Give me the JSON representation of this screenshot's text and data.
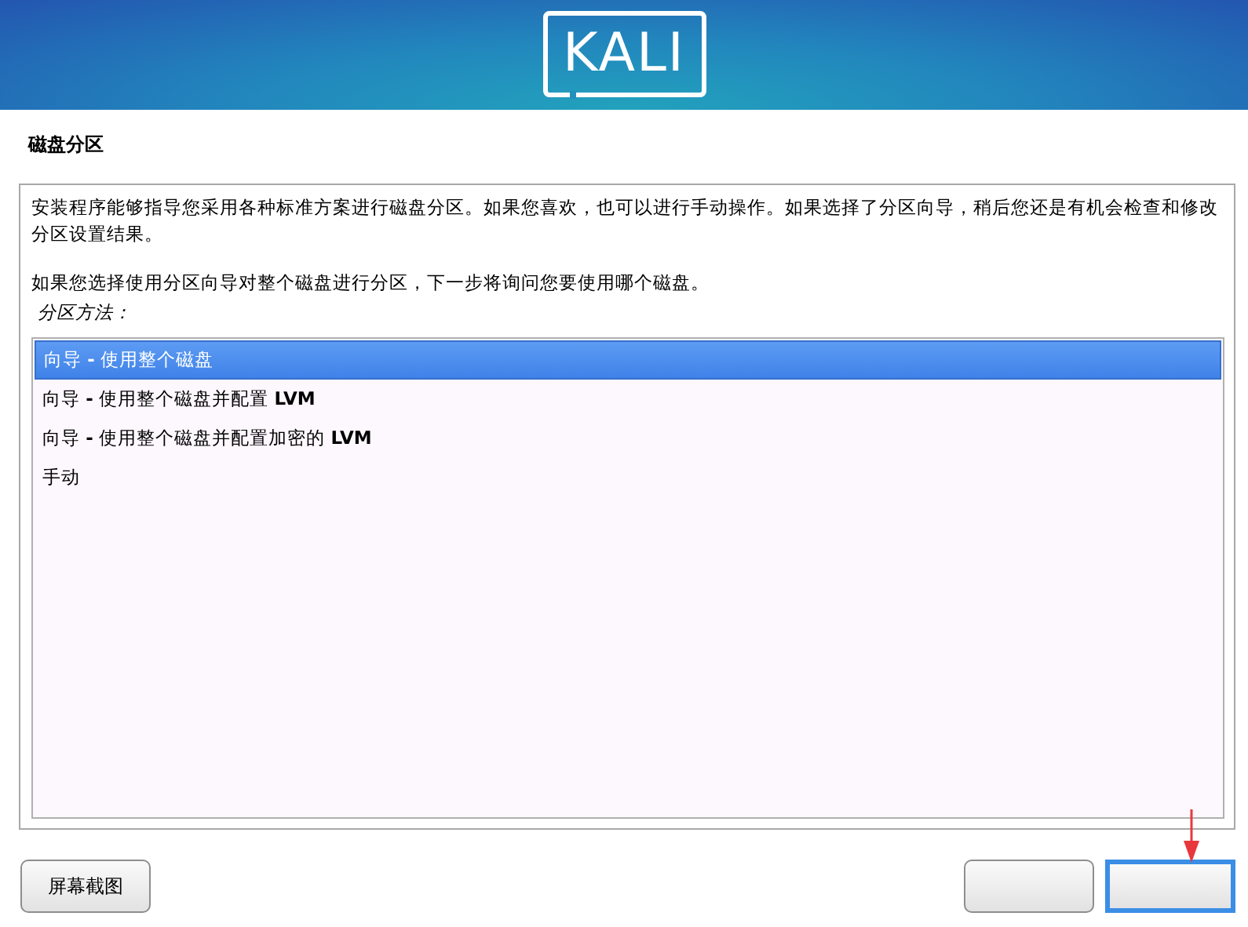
{
  "banner": {
    "logo": "KALI"
  },
  "page_title": "磁盘分区",
  "description": [
    "安装程序能够指导您采用各种标准方案进行磁盘分区。如果您喜欢，也可以进行手动操作。如果选择了分区向导，稍后您还是有机会检查和修改分区设置结果。",
    "如果您选择使用分区向导对整个磁盘进行分区，下一步将询问您要使用哪个磁盘。"
  ],
  "list_label": "分区方法：",
  "options": [
    {
      "label": "向导 **-** 使用整个磁盘",
      "selected": true
    },
    {
      "label": "向导 **-** 使用整个磁盘并配置 **LVM**",
      "selected": false
    },
    {
      "label": "向导 **-** 使用整个磁盘并配置加密的 **LVM**",
      "selected": false
    },
    {
      "label": "手动",
      "selected": false
    }
  ],
  "buttons": [
    {
      "label": "屏幕截图",
      "kind": "left",
      "focused": false
    },
    {
      "kind": "right",
      "focused": false
    },
    {
      "kind": "right",
      "focused": true
    }
  ]
}
